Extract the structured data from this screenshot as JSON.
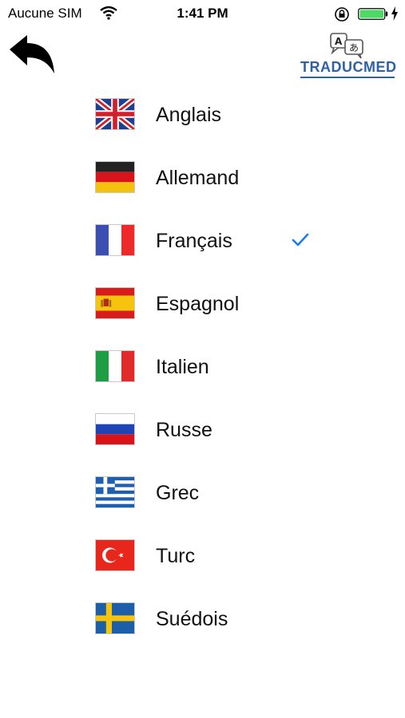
{
  "status_bar": {
    "carrier": "Aucune SIM",
    "time": "1:41 PM",
    "battery_color": "#4cd964"
  },
  "header": {
    "logo_text": "TRADUCMED",
    "logo_color": "#2e61a8",
    "logo_glyph_latin": "A",
    "logo_glyph_kana": "あ"
  },
  "languages": [
    {
      "label": "Anglais",
      "flag": "uk-flag",
      "selected": false
    },
    {
      "label": "Allemand",
      "flag": "germany-flag",
      "selected": false
    },
    {
      "label": "Français",
      "flag": "france-flag",
      "selected": true
    },
    {
      "label": "Espagnol",
      "flag": "spain-flag",
      "selected": false
    },
    {
      "label": "Italien",
      "flag": "italy-flag",
      "selected": false
    },
    {
      "label": "Russe",
      "flag": "russia-flag",
      "selected": false
    },
    {
      "label": "Grec",
      "flag": "greece-flag",
      "selected": false
    },
    {
      "label": "Turc",
      "flag": "turkey-flag",
      "selected": false
    },
    {
      "label": "Suédois",
      "flag": "sweden-flag",
      "selected": false
    }
  ],
  "accent_color": "#1a7cf0"
}
